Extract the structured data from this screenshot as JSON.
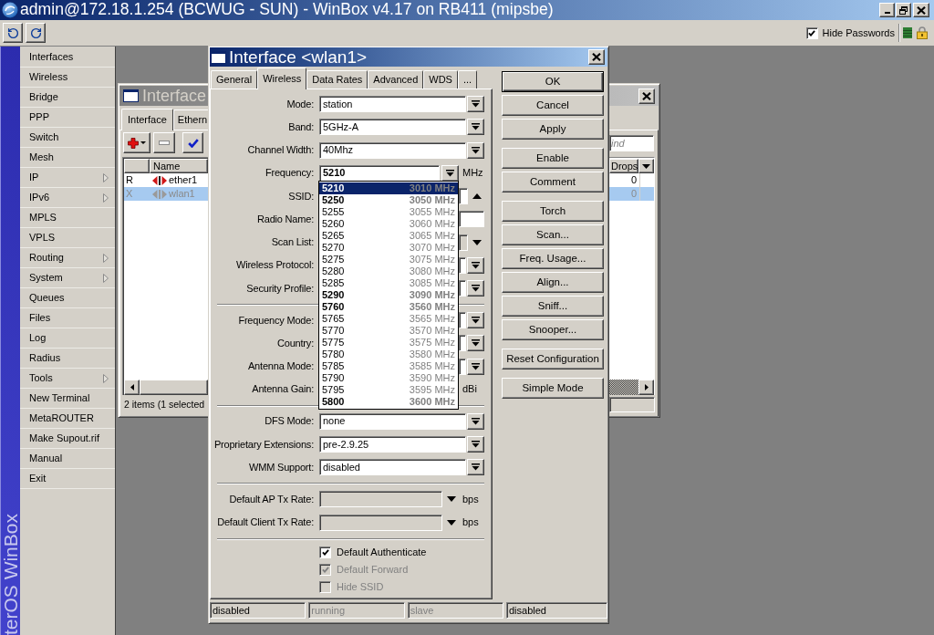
{
  "window": {
    "title": "admin@172.18.1.254 (BCWUG - SUN) - WinBox v4.17 on RB411 (mipsbe)"
  },
  "toolbar": {
    "hide_passwords": {
      "label": "Hide Passwords",
      "checked": true
    }
  },
  "side_banner": {
    "text": "terOS WinBox"
  },
  "sidebar": {
    "items": [
      {
        "label": "Interfaces",
        "submenu": false
      },
      {
        "label": "Wireless",
        "submenu": false
      },
      {
        "label": "Bridge",
        "submenu": false
      },
      {
        "label": "PPP",
        "submenu": false
      },
      {
        "label": "Switch",
        "submenu": false
      },
      {
        "label": "Mesh",
        "submenu": false
      },
      {
        "label": "IP",
        "submenu": true
      },
      {
        "label": "IPv6",
        "submenu": true
      },
      {
        "label": "MPLS",
        "submenu": false
      },
      {
        "label": "VPLS",
        "submenu": false
      },
      {
        "label": "Routing",
        "submenu": true
      },
      {
        "label": "System",
        "submenu": true
      },
      {
        "label": "Queues",
        "submenu": false
      },
      {
        "label": "Files",
        "submenu": false
      },
      {
        "label": "Log",
        "submenu": false
      },
      {
        "label": "Radius",
        "submenu": false
      },
      {
        "label": "Tools",
        "submenu": true
      },
      {
        "label": "New Terminal",
        "submenu": false
      },
      {
        "label": "MetaROUTER",
        "submenu": false
      },
      {
        "label": "Make Supout.rif",
        "submenu": false
      },
      {
        "label": "Manual",
        "submenu": false
      },
      {
        "label": "Exit",
        "submenu": false
      }
    ]
  },
  "interface_list": {
    "title": "Interface",
    "tabs": [
      {
        "label": "Interface",
        "selected": true
      },
      {
        "label": "Ethern",
        "selected": false
      }
    ],
    "find_field": {
      "placeholder": "ind"
    },
    "table": {
      "columns": [
        "Name",
        "Drops"
      ],
      "rows": [
        {
          "flag": "R",
          "name": "ether1",
          "drops": "0",
          "selected": false,
          "disabled": false
        },
        {
          "flag": "X",
          "name": "wlan1",
          "drops": "0",
          "selected": true,
          "disabled": true
        }
      ]
    },
    "status": "2 items (1 selected"
  },
  "interface_dialog": {
    "title": "Interface <wlan1>",
    "tabs": [
      {
        "label": "General",
        "selected": false
      },
      {
        "label": "Wireless",
        "selected": true
      },
      {
        "label": "Data Rates",
        "selected": false
      },
      {
        "label": "Advanced",
        "selected": false
      },
      {
        "label": "WDS",
        "selected": false
      },
      {
        "label": "...",
        "selected": false
      }
    ],
    "sections": [
      {
        "kind": "fields",
        "rows": [
          {
            "label": "Mode:",
            "kind": "select",
            "value": "station"
          },
          {
            "label": "Band:",
            "kind": "select",
            "value": "5GHz-A"
          },
          {
            "label": "Channel Width:",
            "kind": "select",
            "value": "40Mhz"
          },
          {
            "label": "Frequency:",
            "kind": "select",
            "value": "5210",
            "unit": "MHz",
            "emphasized": true,
            "list": {
              "items": [
                {
                  "channel": "5210",
                  "frequency": "3010 MHz",
                  "emphasized": true,
                  "selected": true
                },
                {
                  "channel": "5250",
                  "frequency": "3050 MHz",
                  "emphasized": true,
                  "selected": false
                },
                {
                  "channel": "5255",
                  "frequency": "3055 MHz",
                  "emphasized": false,
                  "selected": false
                },
                {
                  "channel": "5260",
                  "frequency": "3060 MHz",
                  "emphasized": false,
                  "selected": false
                },
                {
                  "channel": "5265",
                  "frequency": "3065 MHz",
                  "emphasized": false,
                  "selected": false
                },
                {
                  "channel": "5270",
                  "frequency": "3070 MHz",
                  "emphasized": false,
                  "selected": false
                },
                {
                  "channel": "5275",
                  "frequency": "3075 MHz",
                  "emphasized": false,
                  "selected": false
                },
                {
                  "channel": "5280",
                  "frequency": "3080 MHz",
                  "emphasized": false,
                  "selected": false
                },
                {
                  "channel": "5285",
                  "frequency": "3085 MHz",
                  "emphasized": false,
                  "selected": false
                },
                {
                  "channel": "5290",
                  "frequency": "3090 MHz",
                  "emphasized": true,
                  "selected": false
                },
                {
                  "channel": "5760",
                  "frequency": "3560 MHz",
                  "emphasized": true,
                  "selected": false
                },
                {
                  "channel": "5765",
                  "frequency": "3565 MHz",
                  "emphasized": false,
                  "selected": false
                },
                {
                  "channel": "5770",
                  "frequency": "3570 MHz",
                  "emphasized": false,
                  "selected": false
                },
                {
                  "channel": "5775",
                  "frequency": "3575 MHz",
                  "emphasized": false,
                  "selected": false
                },
                {
                  "channel": "5780",
                  "frequency": "3580 MHz",
                  "emphasized": false,
                  "selected": false
                },
                {
                  "channel": "5785",
                  "frequency": "3585 MHz",
                  "emphasized": false,
                  "selected": false
                },
                {
                  "channel": "5790",
                  "frequency": "3590 MHz",
                  "emphasized": false,
                  "selected": false
                },
                {
                  "channel": "5795",
                  "frequency": "3595 MHz",
                  "emphasized": false,
                  "selected": false
                },
                {
                  "channel": "5800",
                  "frequency": "3600 MHz",
                  "emphasized": true,
                  "selected": false
                }
              ]
            }
          },
          {
            "label": "SSID:",
            "kind": "removable"
          },
          {
            "label": "Radio Name:",
            "kind": "text"
          },
          {
            "label": "Scan List:",
            "kind": "addable",
            "disabled": true
          },
          {
            "label": "Wireless Protocol:",
            "kind": "select"
          },
          {
            "label": "Security Profile:",
            "kind": "select"
          }
        ]
      },
      {
        "kind": "fields",
        "rows": [
          {
            "label": "Frequency Mode:",
            "kind": "select"
          },
          {
            "label": "Country:",
            "kind": "select"
          },
          {
            "label": "Antenna Mode:",
            "kind": "select"
          },
          {
            "label": "Antenna Gain:",
            "kind": "text",
            "unit": "dBi"
          }
        ]
      },
      {
        "kind": "fields",
        "rows": [
          {
            "label": "DFS Mode:",
            "kind": "select",
            "value": "none"
          },
          {
            "label": "Proprietary Extensions:",
            "kind": "select",
            "value": "pre-2.9.25"
          },
          {
            "label": "WMM Support:",
            "kind": "select",
            "value": "disabled"
          }
        ]
      },
      {
        "kind": "fields",
        "rows": [
          {
            "label": "Default AP Tx Rate:",
            "kind": "addable",
            "unit": "bps",
            "disabled": true
          },
          {
            "label": "Default Client Tx Rate:",
            "kind": "addable",
            "unit": "bps",
            "disabled": true
          }
        ]
      },
      {
        "kind": "checkboxes",
        "items": [
          {
            "label": "Default Authenticate",
            "checked": true,
            "disabled": false
          },
          {
            "label": "Default Forward",
            "checked": true,
            "disabled": true
          },
          {
            "label": "Hide SSID",
            "checked": false,
            "disabled": true
          }
        ]
      }
    ],
    "button_groups": [
      [
        {
          "label": "OK",
          "default": true
        },
        {
          "label": "Cancel",
          "default": false
        },
        {
          "label": "Apply",
          "default": false
        }
      ],
      [
        {
          "label": "Enable",
          "default": false
        },
        {
          "label": "Comment",
          "default": false
        }
      ],
      [
        {
          "label": "Torch",
          "default": false
        },
        {
          "label": "Scan...",
          "default": false
        },
        {
          "label": "Freq. Usage...",
          "default": false
        },
        {
          "label": "Align...",
          "default": false
        },
        {
          "label": "Sniff...",
          "default": false
        },
        {
          "label": "Snooper...",
          "default": false
        }
      ],
      [
        {
          "label": "Reset Configuration",
          "default": false
        }
      ],
      [
        {
          "label": "Simple Mode",
          "default": false
        }
      ]
    ],
    "status_bar": [
      {
        "text": "disabled",
        "active": true
      },
      {
        "text": "running",
        "active": false
      },
      {
        "text": "slave",
        "active": false
      },
      {
        "text": "disabled",
        "active": true
      }
    ]
  }
}
